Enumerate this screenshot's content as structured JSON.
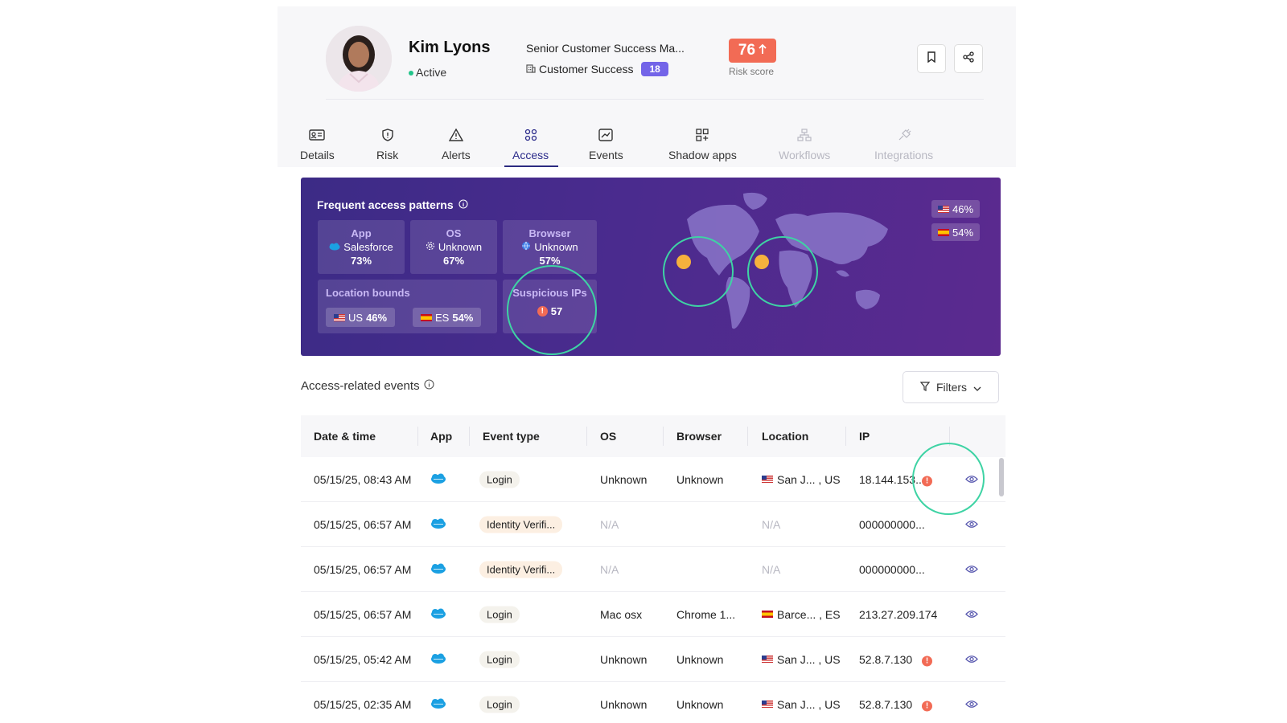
{
  "profile": {
    "name": "Kim Lyons",
    "status": "Active",
    "job_title": "Senior Customer Success Ma...",
    "department": "Customer Success",
    "department_count": "18",
    "risk_score": "76",
    "risk_label": "Risk score"
  },
  "tabs": [
    {
      "label": "Details",
      "icon": "id-card-icon"
    },
    {
      "label": "Risk",
      "icon": "shield-icon"
    },
    {
      "label": "Alerts",
      "icon": "warning-icon"
    },
    {
      "label": "Access",
      "icon": "nodes-icon",
      "active": true
    },
    {
      "label": "Events",
      "icon": "chart-icon"
    },
    {
      "label": "Shadow apps",
      "icon": "apps-icon"
    },
    {
      "label": "Workflows",
      "icon": "workflow-icon",
      "disabled": true
    },
    {
      "label": "Integrations",
      "icon": "plug-icon",
      "disabled": true
    }
  ],
  "patterns": {
    "title": "Frequent access patterns",
    "app": {
      "label": "App",
      "value": "Salesforce",
      "pct": "73%"
    },
    "os": {
      "label": "OS",
      "value": "Unknown",
      "pct": "67%"
    },
    "browser": {
      "label": "Browser",
      "value": "Unknown",
      "pct": "57%"
    },
    "location": {
      "label": "Location bounds",
      "us_code": "US",
      "us_pct": "46%",
      "es_code": "ES",
      "es_pct": "54%"
    },
    "suspicious": {
      "label": "Suspicious IPs",
      "count": "57"
    },
    "map_legend": [
      {
        "flag": "US",
        "pct": "46%"
      },
      {
        "flag": "ES",
        "pct": "54%"
      }
    ]
  },
  "events": {
    "title": "Access-related events",
    "filters_label": "Filters",
    "columns": [
      "Date & time",
      "App",
      "Event type",
      "OS",
      "Browser",
      "Location",
      "IP"
    ],
    "rows": [
      {
        "date": "05/15/25, 08:43 AM",
        "event": "Login",
        "event_kind": "login",
        "os": "Unknown",
        "browser": "Unknown",
        "flag": "US",
        "location": "San J... , US",
        "ip": "18.144.153...",
        "alert": true
      },
      {
        "date": "05/15/25, 06:57 AM",
        "event": "Identity Verifi...",
        "event_kind": "idv",
        "os": "N/A",
        "browser": "",
        "flag": "",
        "location": "N/A",
        "ip": "000000000...",
        "alert": false
      },
      {
        "date": "05/15/25, 06:57 AM",
        "event": "Identity Verifi...",
        "event_kind": "idv",
        "os": "N/A",
        "browser": "",
        "flag": "",
        "location": "N/A",
        "ip": "000000000...",
        "alert": false
      },
      {
        "date": "05/15/25, 06:57 AM",
        "event": "Login",
        "event_kind": "login",
        "os": "Mac osx",
        "browser": "Chrome 1...",
        "flag": "ES",
        "location": "Barce... , ES",
        "ip": "213.27.209.174",
        "alert": false
      },
      {
        "date": "05/15/25, 05:42 AM",
        "event": "Login",
        "event_kind": "login",
        "os": "Unknown",
        "browser": "Unknown",
        "flag": "US",
        "location": "San J... , US",
        "ip": "52.8.7.130",
        "alert": true
      },
      {
        "date": "05/15/25, 02:35 AM",
        "event": "Login",
        "event_kind": "login",
        "os": "Unknown",
        "browser": "Unknown",
        "flag": "US",
        "location": "San J... , US",
        "ip": "52.8.7.130",
        "alert": true
      }
    ]
  }
}
